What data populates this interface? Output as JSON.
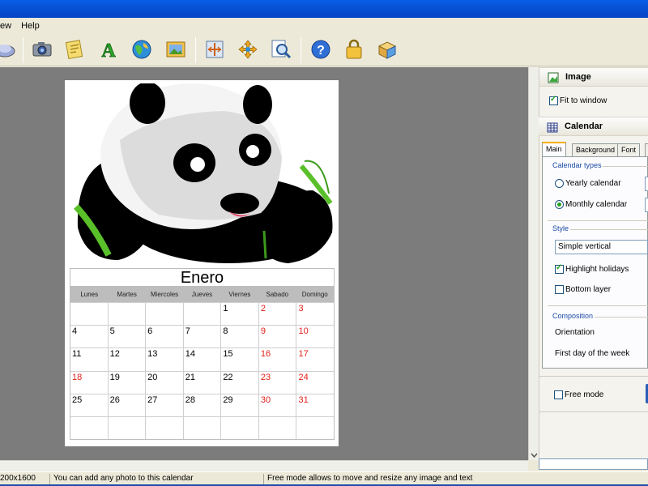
{
  "menu": {
    "items": [
      "ew",
      "Help"
    ]
  },
  "toolbar": {
    "buttons": [
      "open-icon",
      "camera-icon",
      "notes-icon",
      "text-icon",
      "globe-icon",
      "picture-icon",
      "fit-icon",
      "move-icon",
      "zoom-icon",
      "help-icon",
      "lock-icon",
      "package-icon"
    ]
  },
  "calendar": {
    "month": "Enero",
    "weekdays": [
      "Lunes",
      "Martes",
      "Miercoles",
      "Jueves",
      "Viernes",
      "Sabado",
      "Domingo"
    ],
    "weeks": [
      [
        "",
        "",
        "",
        "",
        "1",
        "2",
        "3"
      ],
      [
        "4",
        "5",
        "6",
        "7",
        "8",
        "9",
        "10"
      ],
      [
        "11",
        "12",
        "13",
        "14",
        "15",
        "16",
        "17"
      ],
      [
        "18",
        "19",
        "20",
        "21",
        "22",
        "23",
        "24"
      ],
      [
        "25",
        "26",
        "27",
        "28",
        "29",
        "30",
        "31"
      ],
      [
        "",
        "",
        "",
        "",
        "",
        "",
        ""
      ]
    ],
    "holiday_color": "#e0201a"
  },
  "panel": {
    "image_section": {
      "title": "Image",
      "fit_to_window": "Fit to window",
      "fit_checked": true
    },
    "calendar_section": {
      "title": "Calendar"
    },
    "tabs": [
      "Main",
      "Background",
      "Font"
    ],
    "calendar_types": {
      "label": "Calendar types",
      "yearly": "Yearly calendar",
      "monthly": "Monthly calendar",
      "selected": "monthly"
    },
    "style": {
      "label": "Style",
      "selected": "Simple vertical",
      "highlight_holidays": "Highlight holidays",
      "highlight_checked": true,
      "bottom_layer": "Bottom layer",
      "bottom_checked": false
    },
    "composition": {
      "label": "Composition",
      "orientation": "Orientation",
      "first_day": "First day of the week"
    },
    "free_mode": "Free mode"
  },
  "status": {
    "size": "200x1600",
    "hint1": "You can add any photo to this calendar",
    "hint2": "Free mode allows to move and resize any image and text"
  }
}
